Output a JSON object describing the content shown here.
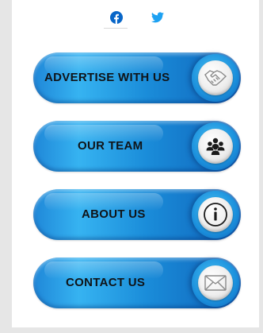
{
  "social": {
    "facebook_icon": "facebook-icon",
    "twitter_icon": "twitter-icon",
    "facebook_color": "#0866c8",
    "twitter_color": "#1da1f2"
  },
  "buttons": [
    {
      "label": "ADVERTISE WITH US",
      "icon": "handshake-icon"
    },
    {
      "label": "OUR TEAM",
      "icon": "team-icon"
    },
    {
      "label": "ABOUT US",
      "icon": "info-icon"
    },
    {
      "label": "CONTACT US",
      "icon": "envelope-icon"
    }
  ],
  "colors": {
    "pill_blue": "#1a8cd9",
    "label_text": "#101418",
    "page_background": "#e6e6e6"
  }
}
